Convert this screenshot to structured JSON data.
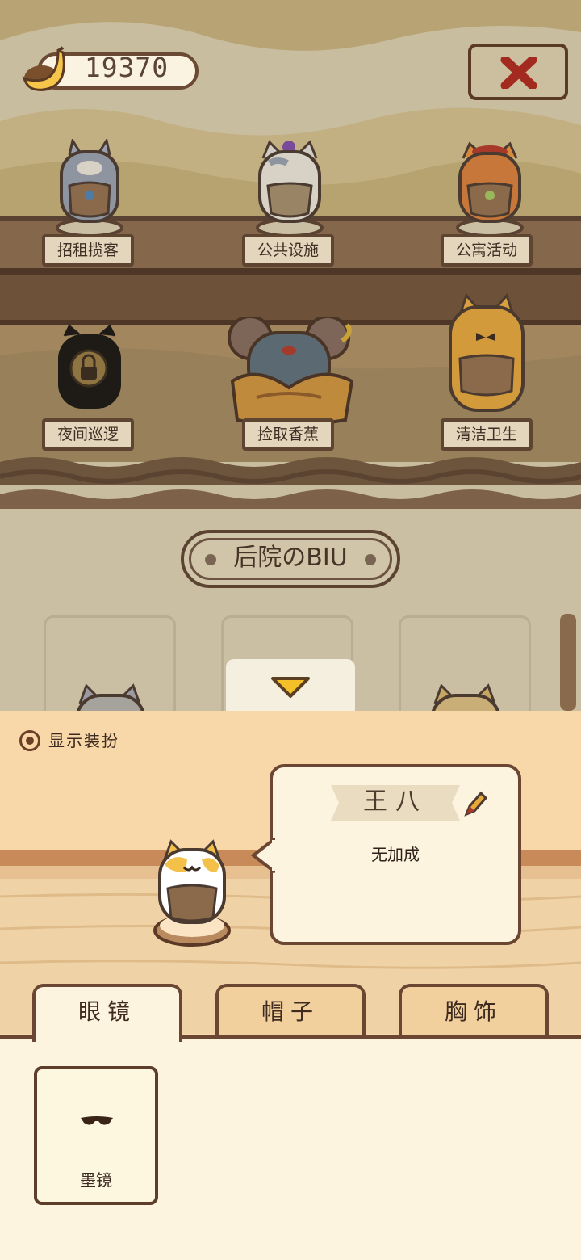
{
  "currency": {
    "icon": "banana-icon",
    "amount": "19370"
  },
  "close": {
    "icon": "close-icon"
  },
  "jobs": [
    {
      "label": "招租揽客",
      "locked": false
    },
    {
      "label": "公共设施",
      "locked": false
    },
    {
      "label": "公寓活动",
      "locked": false
    },
    {
      "label": "夜间巡逻",
      "locked": true
    },
    {
      "label": "捡取香蕉",
      "locked": false
    },
    {
      "label": "清洁卫生",
      "locked": false
    }
  ],
  "section": {
    "title": "后院のBIU"
  },
  "collapse": {
    "icon": "chevron-down-icon"
  },
  "panel": {
    "show_dress_label": "显示装扮",
    "cat_name": "王八",
    "bonus": "无加成",
    "edit_icon": "pencil-icon",
    "tabs": [
      {
        "label": "眼镜",
        "active": true
      },
      {
        "label": "帽子",
        "active": false
      },
      {
        "label": "胸饰",
        "active": false
      }
    ],
    "items": [
      {
        "label": "墨镜",
        "icon": "sunglasses-icon"
      }
    ]
  },
  "colors": {
    "brown_outline": "#6a4633",
    "panel_bg": "#f8d8a8",
    "cream": "#fdf4df",
    "close_red": "#a82a1f"
  }
}
